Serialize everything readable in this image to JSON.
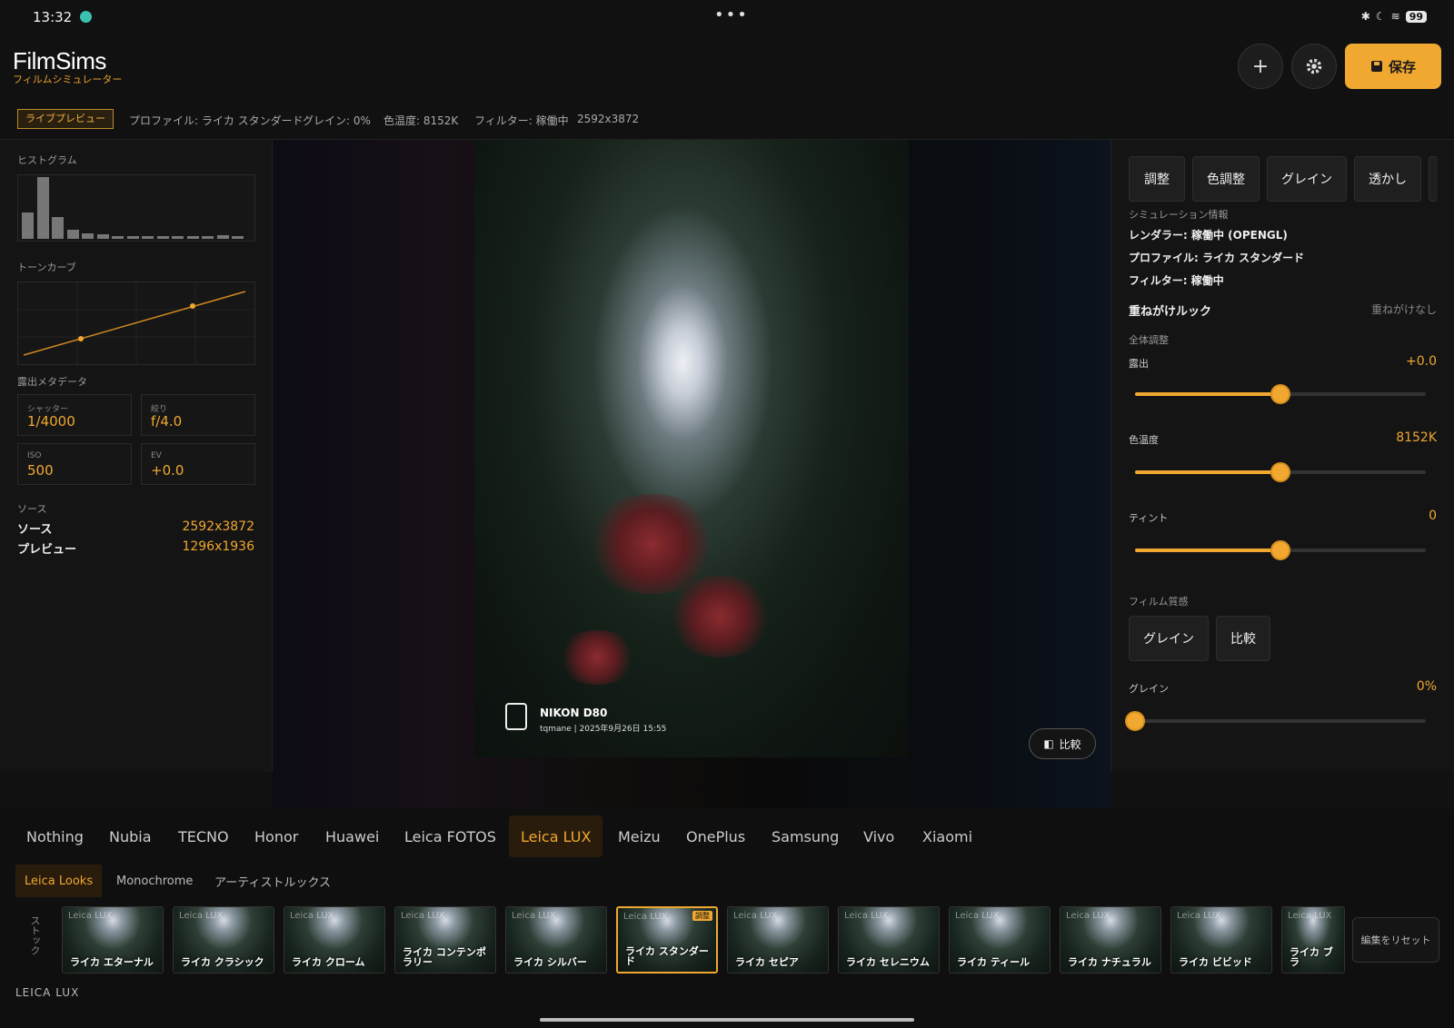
{
  "status": {
    "time": "13:32",
    "menu": "•••",
    "battery": "99",
    "bt": "✱",
    "moon": "☾",
    "wifi": "≋"
  },
  "header": {
    "title": "FilmSims",
    "subtitle": "フィルムシミュレーター",
    "add_icon": "plus-icon",
    "settings_icon": "gear-icon",
    "save_label": "保存",
    "accent": "#f0a830"
  },
  "info": {
    "live": "ライブプレビュー",
    "profile": "プロファイル: ライカ スタンダード",
    "grain": "グレイン: 0%",
    "temp": "色温度: 8152K",
    "filter": "フィルター: 稼働中",
    "size": "2592x3872"
  },
  "left": {
    "histogram_label": "ヒストグラム",
    "histogram_values": [
      0.42,
      1.0,
      0.36,
      0.14,
      0.09,
      0.07,
      0.05,
      0.05,
      0.04,
      0.04,
      0.04,
      0.04,
      0.04,
      0.06,
      0.04
    ],
    "tonecurve_label": "トーンカーブ",
    "exposure_label": "露出メタデータ",
    "shutter_k": "シャッター",
    "shutter_v": "1/4000",
    "aperture_k": "絞り",
    "aperture_v": "f/4.0",
    "iso_k": "ISO",
    "iso_v": "500",
    "ev_k": "EV",
    "ev_v": "+0.0",
    "source_label": "ソース",
    "source_k": "ソース",
    "source_v": "2592x3872",
    "preview_k": "プレビュー",
    "preview_v": "1296x1936"
  },
  "photo": {
    "camera": "NIKON D80",
    "sub": "tqmane | 2025年9月26日 15:55",
    "compare": "比較"
  },
  "right": {
    "tabs": [
      "調整",
      "色調整",
      "グレイン",
      "透かし"
    ],
    "sim_label": "シミュレーション情報",
    "renderer": "レンダラー: 稼働中 (OPENGL)",
    "profile": "プロファイル: ライカ スタンダード",
    "filter": "フィルター: 稼働中",
    "overlay_k": "重ねがけルック",
    "overlay_v": "重ねがけなし",
    "global_label": "全体調整",
    "exposure_k": "露出",
    "exposure_v": "+0.0",
    "exposure_pos": 0.5,
    "temp_k": "色温度",
    "temp_v": "8152K",
    "temp_pos": 0.5,
    "tint_k": "ティント",
    "tint_v": "0",
    "tint_pos": 0.5,
    "film_label": "フィルム質感",
    "btn_grain": "グレイン",
    "btn_compare": "比較",
    "grain_k": "グレイン",
    "grain_v": "0%",
    "grain_pos": 0.0
  },
  "bottom": {
    "brands": [
      "Nothing",
      "Nubia",
      "TECNO",
      "Honor",
      "Huawei",
      "Leica FOTOS",
      "Leica LUX",
      "Meizu",
      "OnePlus",
      "Samsung",
      "Vivo",
      "Xiaomi"
    ],
    "active_brand": "Leica LUX",
    "cats": [
      "Leica Looks",
      "Monochrome",
      "アーティストルックス"
    ],
    "stock": "ストック",
    "thumb_brand": "Leica LUX",
    "thumbs": [
      "ライカ エターナル",
      "ライカ クラシック",
      "ライカ クローム",
      "ライカ コンテンポラリー",
      "ライカ シルバー",
      "ライカ スタンダード",
      "ライカ セピア",
      "ライカ セレニウム",
      "ライカ ティール",
      "ライカ ナチュラル",
      "ライカ ビビッド",
      "ライカ ブラ"
    ],
    "active_badge": "調整",
    "reset": "編集をリセット",
    "footer": "LEICA LUX"
  }
}
